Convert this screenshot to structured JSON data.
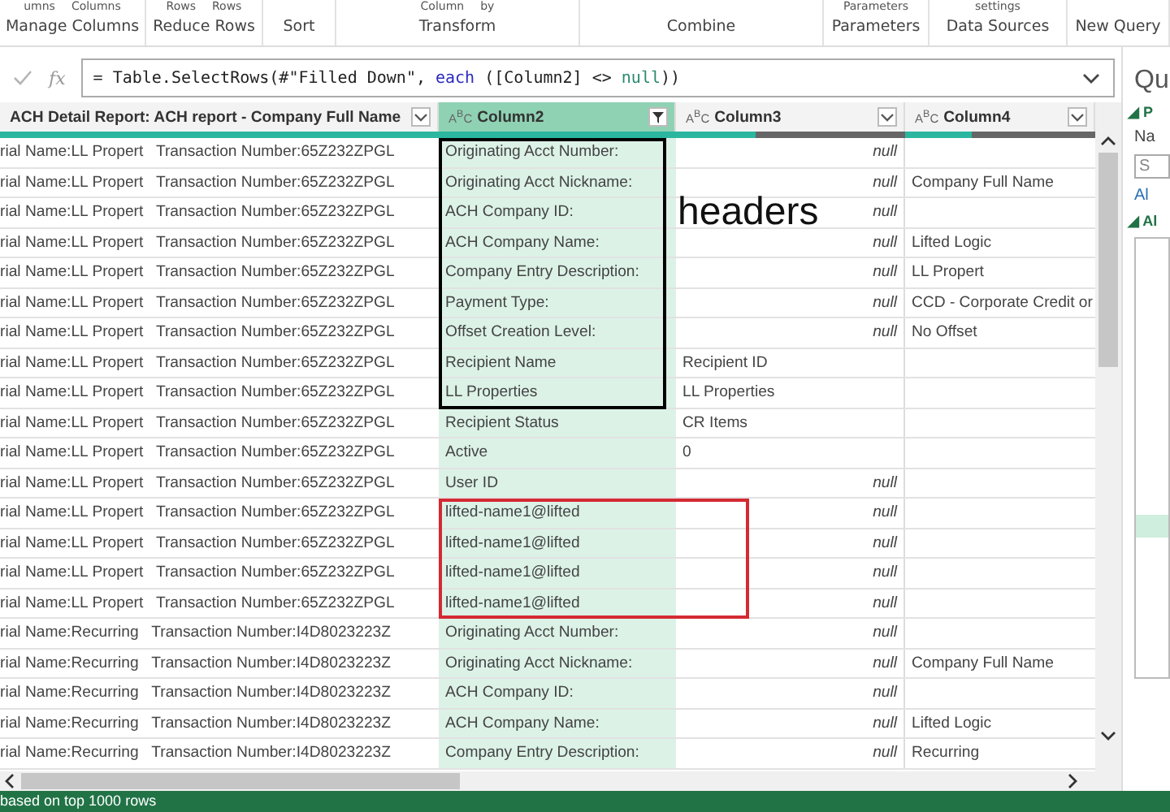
{
  "ribbon": [
    {
      "label": "Manage Columns",
      "buttons": [
        "umns",
        "Columns"
      ]
    },
    {
      "label": "Reduce Rows",
      "buttons": [
        "Rows",
        "Rows"
      ]
    },
    {
      "label": "Sort"
    },
    {
      "label": "Transform",
      "buttons": [
        "Column",
        "by"
      ]
    },
    {
      "label": "Combine"
    },
    {
      "label": "Parameters",
      "buttons": [
        "Parameters"
      ]
    },
    {
      "label": "Data Sources",
      "buttons": [
        "settings"
      ]
    },
    {
      "label": "New Query"
    }
  ],
  "formula_bar": {
    "fx": "fx",
    "formula": [
      {
        "text": "= Table.SelectRows(#\"Filled Down\", ",
        "kind": "plain"
      },
      {
        "text": "each",
        "kind": "keyword"
      },
      {
        "text": " ([Column2] <> ",
        "kind": "plain"
      },
      {
        "text": "null",
        "kind": "constant"
      },
      {
        "text": "))",
        "kind": "plain"
      }
    ]
  },
  "columns": [
    {
      "name": "ACH Detail Report: ACH report - Company Full Name",
      "selected": false,
      "filtered": false
    },
    {
      "name": "Column2",
      "type_label": "A$^{B}$C",
      "selected": true,
      "filtered": true
    },
    {
      "name": "Column3",
      "type_label": "A$^{B}$C",
      "selected": false,
      "filtered": false
    },
    {
      "name": "Column4",
      "type_label": "A$^{B}$C",
      "selected": false,
      "filtered": false
    }
  ],
  "rows": [
    {
      "column_1": "rial Name:LL Propert   Transaction Number:65Z232ZPGL",
      "column_2": "Originating Acct Number:",
      "column_3": {
        "text": "null",
        "kind": "null"
      },
      "column_4": "",
      "color": "#000000"
    },
    {
      "column_1": "rial Name:LL Propert   Transaction Number:65Z232ZPGL",
      "column_2": "Originating Acct Nickname:",
      "column_3": {
        "text": "null",
        "kind": "null"
      },
      "column_4": "Company Full Name",
      "color": "#000000"
    },
    {
      "column_1": "rial Name:LL Propert   Transaction Number:65Z232ZPGL",
      "column_2": "ACH Company ID:",
      "column_3": {
        "text": "null",
        "kind": "null"
      },
      "column_4": "",
      "color": "#000000",
      "note": "headers"
    },
    {
      "column_1": "rial Name:LL Propert   Transaction Number:65Z232ZPGL",
      "column_2": "ACH Company Name:",
      "column_3": {
        "text": "null",
        "kind": "null"
      },
      "column_4": "Lifted Logic",
      "color": "#000000"
    },
    {
      "column_1": "rial Name:LL Propert   Transaction Number:65Z232ZPGL",
      "column_2": "Company Entry Description:",
      "column_3": {
        "text": "null",
        "kind": "null"
      },
      "column_4": "LL Propert",
      "color": "#000000"
    },
    {
      "column_1": "rial Name:LL Propert   Transaction Number:65Z232ZPGL",
      "column_2": "Payment Type:",
      "column_3": {
        "text": "null",
        "kind": "null"
      },
      "column_4": "CCD - Corporate Credit or",
      "color": "#000000"
    },
    {
      "column_1": "rial Name:LL Propert   Transaction Number:65Z232ZPGL",
      "column_2": "Offset Creation Level:",
      "column_3": {
        "text": "null",
        "kind": "null"
      },
      "column_4": "No Offset",
      "color": "#000000"
    },
    {
      "column_1": "rial Name:LL Propert   Transaction Number:65Z232ZPGL",
      "column_2": "Recipient Name",
      "column_3": {
        "text": "Recipient ID",
        "kind": "value"
      },
      "column_4": "",
      "color": "#000000"
    },
    {
      "column_1": "rial Name:LL Propert   Transaction Number:65Z232ZPGL",
      "column_2": "LL Properties",
      "column_3": {
        "text": "LL Properties",
        "kind": "value"
      },
      "column_4": "",
      "color": "#000000"
    },
    {
      "column_1": "rial Name:LL Propert   Transaction Number:65Z232ZPGL",
      "column_2": "Recipient Status",
      "column_3": {
        "text": "CR Items",
        "kind": "value"
      },
      "column_4": ""
    },
    {
      "column_1": "rial Name:LL Propert   Transaction Number:65Z232ZPGL",
      "column_2": "Active",
      "column_3": {
        "text": "0",
        "kind": "value"
      },
      "column_4": ""
    },
    {
      "column_1": "rial Name:LL Propert   Transaction Number:65Z232ZPGL",
      "column_2": "User ID",
      "column_3": {
        "text": "null",
        "kind": "null"
      },
      "column_4": ""
    },
    {
      "column_1": "rial Name:LL Propert   Transaction Number:65Z232ZPGL",
      "column_2": "lifted-name1@lifted",
      "column_3": {
        "text": "null",
        "kind": "null"
      },
      "column_4": "",
      "color": "#d42a32"
    },
    {
      "column_1": "rial Name:LL Propert   Transaction Number:65Z232ZPGL",
      "column_2": "lifted-name1@lifted",
      "column_3": {
        "text": "null",
        "kind": "null"
      },
      "column_4": "",
      "color": "#d42a32"
    },
    {
      "column_1": "rial Name:LL Propert   Transaction Number:65Z232ZPGL",
      "column_2": "lifted-name1@lifted",
      "column_3": {
        "text": "null",
        "kind": "null"
      },
      "column_4": "",
      "color": "#d42a32"
    },
    {
      "column_1": "rial Name:LL Propert   Transaction Number:65Z232ZPGL",
      "column_2": "lifted-name1@lifted",
      "column_3": {
        "text": "null",
        "kind": "null"
      },
      "column_4": "",
      "color": "#d42a32"
    },
    {
      "column_1": "rial Name:Recurring   Transaction Number:I4D8023223Z",
      "column_2": "Originating Acct Number:",
      "column_3": {
        "text": "null",
        "kind": "null"
      },
      "column_4": ""
    },
    {
      "column_1": "rial Name:Recurring   Transaction Number:I4D8023223Z",
      "column_2": "Originating Acct Nickname:",
      "column_3": {
        "text": "null",
        "kind": "null"
      },
      "column_4": "Company Full Name"
    },
    {
      "column_1": "rial Name:Recurring   Transaction Number:I4D8023223Z",
      "column_2": "ACH Company ID:",
      "column_3": {
        "text": "null",
        "kind": "null"
      },
      "column_4": ""
    },
    {
      "column_1": "rial Name:Recurring   Transaction Number:I4D8023223Z",
      "column_2": "ACH Company Name:",
      "column_3": {
        "text": "null",
        "kind": "null"
      },
      "column_4": "Lifted Logic"
    },
    {
      "column_1": "rial Name:Recurring   Transaction Number:I4D8023223Z",
      "column_2": "Company Entry Description:",
      "column_3": {
        "text": "null",
        "kind": "null"
      },
      "column_4": "Recurring"
    }
  ],
  "query_pane": {
    "title": "Qu",
    "properties_heading": "◢ P",
    "name_label": "Na",
    "name_value": "S",
    "all_link": "Al",
    "applied_heading": "◢ Al"
  },
  "status_bar": "based on top 1000 rows"
}
